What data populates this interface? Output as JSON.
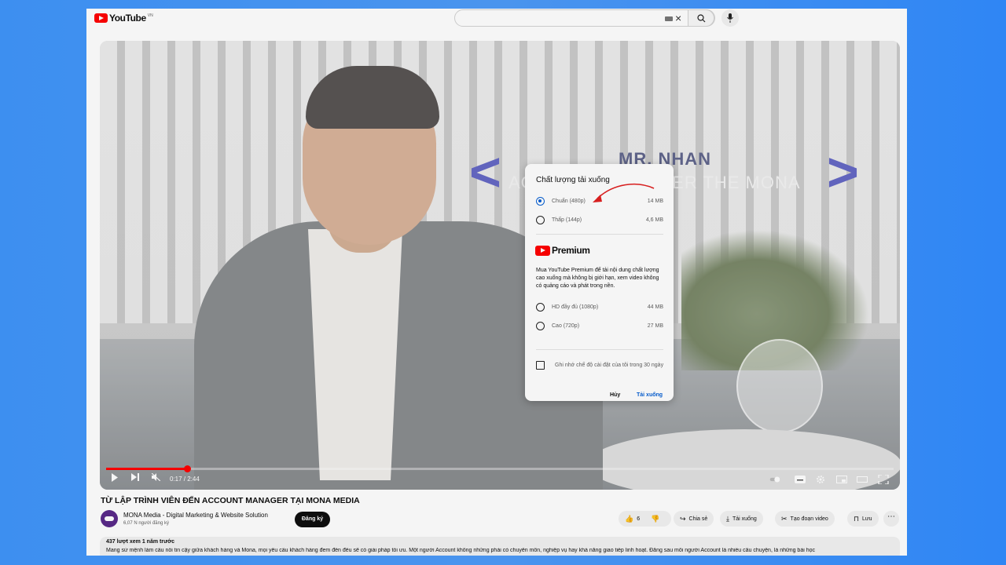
{
  "header": {
    "logo_text": "YouTube",
    "country_code": "VN"
  },
  "video": {
    "overlay_name": "MR. NHAN",
    "overlay_role": "ACCOUNT MANAGER THE MONA",
    "time": "0:17 / 2:44",
    "progress_fraction": 0.103
  },
  "dialog": {
    "title": "Chất lượng tải xuống",
    "options": [
      {
        "label": "Chuẩn (480p)",
        "size": "14 MB",
        "selected": true
      },
      {
        "label": "Thấp (144p)",
        "size": "4,6 MB",
        "selected": false
      }
    ],
    "premium_label": "Premium",
    "promo": "Mua YouTube Premium để tải nội dung chất lượng cao xuống mà không bị giới hạn, xem video không có quảng cáo và phát trong nền.",
    "premium_options": [
      {
        "label": "HD đầy đủ (1080p)",
        "size": "44 MB"
      },
      {
        "label": "Cao (720p)",
        "size": "27 MB"
      }
    ],
    "remember": "Ghi nhớ chế độ cài đặt của tôi trong 30 ngày",
    "cancel": "Hủy",
    "download": "Tải xuống"
  },
  "page": {
    "title": "TỪ LẬP TRÌNH VIÊN ĐẾN ACCOUNT MANAGER TẠI MONA MEDIA",
    "channel": "MONA Media - Digital Marketing & Website Solution",
    "subscribers": "6,07 N người đăng ký",
    "subscribe": "Đăng ký",
    "likes": "6",
    "share": "Chia sẻ",
    "download": "Tải xuống",
    "clip": "Tạo đoạn video",
    "save": "Lưu",
    "views": "437 lượt xem  1 năm trước",
    "description": "Mang sứ mệnh làm cầu nối tin cậy giữa khách hàng và Mona, mọi yêu cầu khách hàng đem đến đều sẽ có giải pháp tối ưu. Một người Account không những phải có chuyên môn, nghiệp vụ hay khả năng giao tiếp linh hoạt. Đằng sau mỗi người Account là nhiều câu chuyện, là những bài học"
  },
  "colors": {
    "accent": "#065fd4",
    "brand": "#ff0000",
    "background": "#3d8ff0"
  }
}
